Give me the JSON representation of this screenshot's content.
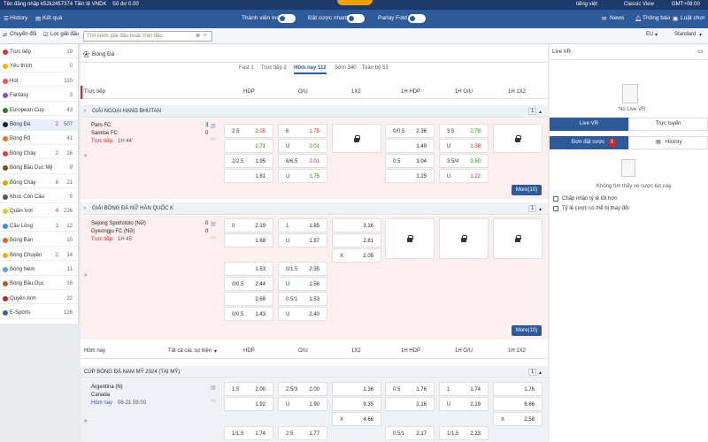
{
  "topbar": {
    "username": "Tên đăng nhập k52k2457374",
    "currency": "Tiền tệ VNDK",
    "balance": "Số dư 0.00",
    "language": "tiếng việt",
    "view": "Classic View",
    "timezone": "GMT+08:00"
  },
  "nav": {
    "history": "History",
    "results": "Kết quả",
    "new_member": "Thành viên mới",
    "quick_bet": "Đặt cược nhanh",
    "parlay": "Parlay Fold",
    "news": "News",
    "notice": "Thông báo",
    "rules": "Luật chơi"
  },
  "filter": {
    "switch": "Chuyển đổi",
    "league_filter": "Lọc giải đấu",
    "search_placeholder": "Tìm kiếm giải đấu hoặc trận đấu",
    "odds_type": "EU",
    "display": "Standard"
  },
  "sidebar": [
    {
      "label": "Trực tiếp",
      "count": "19",
      "live": "",
      "color": "#d33"
    },
    {
      "label": "Yêu thích",
      "count": "0",
      "live": "",
      "color": "#f5b400"
    },
    {
      "label": "Hot",
      "count": "110",
      "live": "",
      "color": "#e55"
    },
    {
      "label": "Fantasy",
      "count": "3",
      "live": "",
      "color": "#8a4fd0"
    },
    {
      "label": "European Cup",
      "count": "43",
      "live": "",
      "color": "#2a7a2a"
    },
    {
      "label": "Bóng Đá",
      "count": "507",
      "live": "2",
      "color": "#222"
    },
    {
      "label": "Bóng Rổ",
      "count": "41",
      "live": "",
      "color": "#e7772a"
    },
    {
      "label": "Bóng Chày",
      "count": "16",
      "live": "2",
      "color": "#e24040"
    },
    {
      "label": "Bóng Bầu Dục Mỹ",
      "count": "9",
      "live": "",
      "color": "#8b4513"
    },
    {
      "label": "Bóng Chày",
      "count": "21",
      "live": "8",
      "color": "#d9a400"
    },
    {
      "label": "Khúc Côn Cầu",
      "count": "5",
      "live": "",
      "color": "#555"
    },
    {
      "label": "Quần Vợt",
      "count": "226",
      "live": "4",
      "color": "#c8d820"
    },
    {
      "label": "Cầu Lông",
      "count": "12",
      "live": "1",
      "color": "#3a8fd8"
    },
    {
      "label": "Bóng Bàn",
      "count": "10",
      "live": "",
      "color": "#e06030"
    },
    {
      "label": "Bóng Chuyền",
      "count": "14",
      "live": "2",
      "color": "#f0b000"
    },
    {
      "label": "Bóng Ném",
      "count": "11",
      "live": "",
      "color": "#5aa0e0"
    },
    {
      "label": "Bóng Bầu Dục",
      "count": "16",
      "live": "",
      "color": "#b05a2a"
    },
    {
      "label": "Quyền Anh",
      "count": "22",
      "live": "",
      "color": "#c22"
    },
    {
      "label": "E-Sports",
      "count": "126",
      "live": "",
      "color": "#3366aa"
    }
  ],
  "main": {
    "sport_title": "Bóng Đá",
    "tabs": [
      "Fast 1",
      "Trực tiếp 2",
      "Hôm nay 112",
      "Sớm 340",
      "Toàn bộ 53"
    ],
    "live_section": "Trực tiếp",
    "today_section": "Hôm nay",
    "all_events": "Tất cả các sự kiện",
    "columns": [
      "HDP",
      "O/U",
      "1X2",
      "1H HDP",
      "1H O/U",
      "1H 1X2"
    ],
    "more": "More(10)",
    "league1": {
      "name": "GIẢI NGOẠI HẠNG BHUTAN",
      "count": "1",
      "home": "Paro FC",
      "away": "Samtse FC",
      "home_score": "3",
      "away_score": "0",
      "status": "Trực tiếp",
      "time": "1H 44'",
      "rows": [
        {
          "hdp_l": "2.5",
          "hdp_h": "2.05",
          "hdp_a": "1.71",
          "ou_l": "6",
          "ou_h": "1.75",
          "ou_u": "U",
          "ou_a": "2.01",
          "h1_l": "0/0.5",
          "h1_h": "2.36",
          "h1_a": "1.49",
          "h1ou_l": "3.5",
          "h1ou_h": "2.78",
          "h1ou_u": "U",
          "h1ou_a": "1.38"
        },
        {
          "hdp_l": "2/2.5",
          "hdp_h": "1.95",
          "hdp_a": "1.81",
          "ou_l": "6/6.5",
          "ou_h": "2.01",
          "ou_u": "U",
          "ou_a": "1.75",
          "h1_l": "0.5",
          "h1_h": "3.04",
          "h1_a": "1.25",
          "h1ou_l": "3.5/4",
          "h1ou_h": "3.50",
          "h1ou_u": "U",
          "h1ou_a": "1.22"
        }
      ]
    },
    "league2": {
      "name": "GIẢI BÓNG ĐÁ NỮ HÀN QUỐC K",
      "count": "1",
      "home": "Sejong Sportstoto (Nữ)",
      "away": "Gyeongju FC (Nữ)",
      "home_score": "0",
      "away_score": "0",
      "status": "Trực tiếp",
      "time": "1H 45'",
      "main": {
        "hdp_l": "0",
        "hdp_h": "2.19",
        "hdp_a": "1.68",
        "ou_l": "1",
        "ou_h": "1.85",
        "ou_u": "U",
        "ou_a": "1.97",
        "x1": "3.16",
        "x2": "2.81",
        "xx": "X",
        "x3": "2.05"
      },
      "alt": [
        {
          "hdp_l": "",
          "hdp_h": "1.53",
          "hdp_al": "0/0.5",
          "hdp_a": "2.44",
          "ou_l": "0/1.5",
          "ou_h": "2.35",
          "ou_u": "U",
          "ou_a": "1.56"
        },
        {
          "hdp_l": "",
          "hdp_h": "2.69",
          "hdp_al": "0/0.5",
          "hdp_a": "1.43",
          "ou_l": "0.5/1",
          "ou_h": "1.53",
          "ou_u": "U",
          "ou_a": "2.40"
        }
      ]
    },
    "league3": {
      "name": "CÚP BÓNG ĐÁ NAM MỸ 2024 (TẠI MỸ)",
      "count": "1",
      "home": "Argentina (N)",
      "away": "Canada",
      "status": "Hôm nay",
      "time": "06-21 08:00",
      "row1": {
        "hdp_l": "1.5",
        "hdp_h": "2.00",
        "hdp_a": "1.92",
        "ou_l": "2.5/3",
        "ou_h": "2.00",
        "ou_u": "U",
        "ou_a": "1.90",
        "x1": "1.36",
        "x2": "9.35",
        "xx": "X",
        "x3": "4.66",
        "h1_l": "0.5",
        "h1_h": "1.76",
        "h1_a": "2.16",
        "h1ou_l": "1",
        "h1ou_h": "1.74",
        "h1ou_u": "U",
        "h1ou_a": "2.19",
        "h1x_1": "1.76",
        "h1x_2": "8.66",
        "h1x_x": "X",
        "h1x_3": "2.58"
      },
      "row2": {
        "hdp_l": "1/1.5",
        "hdp_h": "1.74",
        "ou_l": "2.5",
        "ou_h": "1.77",
        "h1_l": "0.5/1",
        "h1_h": "2.17",
        "h1ou_l": "1/1.5",
        "h1ou_h": "2.23"
      }
    }
  },
  "right": {
    "live_vr_title": "Live VR",
    "no_live_vr": "No Live VR",
    "tab_live_vr": "Live VR",
    "tab_live": "Trực tuyến",
    "tab_bets": "Đơn đặt cược",
    "bets_count": "0",
    "tab_history": "History",
    "no_bets": "Không tìm thấy vé cược lúc này",
    "opt1": "Chấp nhận tỷ lệ tốt hơn",
    "opt2": "Tỷ lệ cược có thể bị thay đổi"
  }
}
